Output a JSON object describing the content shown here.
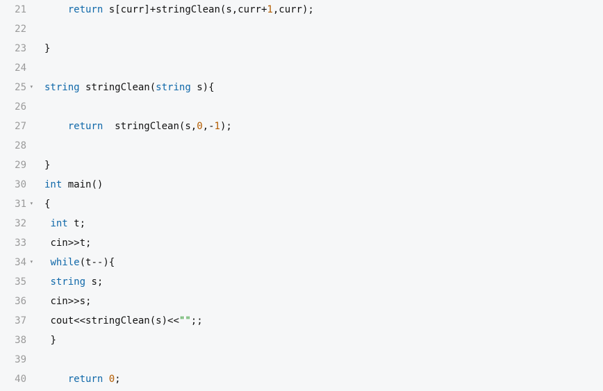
{
  "editor": {
    "first_line_number": 21,
    "lines": [
      {
        "num": 21,
        "fold": false,
        "indent": "    ",
        "tokens": [
          {
            "t": "return",
            "c": "keyword"
          },
          {
            "t": " ",
            "c": "plain"
          },
          {
            "t": "s",
            "c": "ident"
          },
          {
            "t": "[",
            "c": "punct"
          },
          {
            "t": "curr",
            "c": "ident"
          },
          {
            "t": "]",
            "c": "punct"
          },
          {
            "t": "+",
            "c": "op"
          },
          {
            "t": "stringClean",
            "c": "func"
          },
          {
            "t": "(",
            "c": "punct"
          },
          {
            "t": "s",
            "c": "ident"
          },
          {
            "t": ",",
            "c": "punct"
          },
          {
            "t": "curr",
            "c": "ident"
          },
          {
            "t": "+",
            "c": "op"
          },
          {
            "t": "1",
            "c": "num"
          },
          {
            "t": ",",
            "c": "punct"
          },
          {
            "t": "curr",
            "c": "ident"
          },
          {
            "t": ")",
            "c": "punct"
          },
          {
            "t": ";",
            "c": "punct"
          }
        ]
      },
      {
        "num": 22,
        "fold": false,
        "indent": "",
        "tokens": []
      },
      {
        "num": 23,
        "fold": false,
        "indent": "",
        "tokens": [
          {
            "t": "}",
            "c": "brace"
          }
        ]
      },
      {
        "num": 24,
        "fold": false,
        "indent": "",
        "tokens": []
      },
      {
        "num": 25,
        "fold": true,
        "indent": "",
        "tokens": [
          {
            "t": "string",
            "c": "type"
          },
          {
            "t": " ",
            "c": "plain"
          },
          {
            "t": "stringClean",
            "c": "func"
          },
          {
            "t": "(",
            "c": "punct"
          },
          {
            "t": "string",
            "c": "type"
          },
          {
            "t": " ",
            "c": "plain"
          },
          {
            "t": "s",
            "c": "ident"
          },
          {
            "t": ")",
            "c": "punct"
          },
          {
            "t": "{",
            "c": "brace"
          }
        ]
      },
      {
        "num": 26,
        "fold": false,
        "indent": "",
        "tokens": []
      },
      {
        "num": 27,
        "fold": false,
        "indent": "    ",
        "tokens": [
          {
            "t": "return",
            "c": "keyword"
          },
          {
            "t": "  ",
            "c": "plain"
          },
          {
            "t": "stringClean",
            "c": "func"
          },
          {
            "t": "(",
            "c": "punct"
          },
          {
            "t": "s",
            "c": "ident"
          },
          {
            "t": ",",
            "c": "punct"
          },
          {
            "t": "0",
            "c": "num"
          },
          {
            "t": ",",
            "c": "punct"
          },
          {
            "t": "-",
            "c": "op"
          },
          {
            "t": "1",
            "c": "num"
          },
          {
            "t": ")",
            "c": "punct"
          },
          {
            "t": ";",
            "c": "punct"
          }
        ]
      },
      {
        "num": 28,
        "fold": false,
        "indent": "",
        "tokens": []
      },
      {
        "num": 29,
        "fold": false,
        "indent": "",
        "tokens": [
          {
            "t": "}",
            "c": "brace"
          }
        ]
      },
      {
        "num": 30,
        "fold": false,
        "indent": "",
        "tokens": [
          {
            "t": "int",
            "c": "type"
          },
          {
            "t": " ",
            "c": "plain"
          },
          {
            "t": "main",
            "c": "func"
          },
          {
            "t": "(",
            "c": "punct"
          },
          {
            "t": ")",
            "c": "punct"
          }
        ]
      },
      {
        "num": 31,
        "fold": true,
        "indent": "",
        "tokens": [
          {
            "t": "{",
            "c": "brace"
          }
        ]
      },
      {
        "num": 32,
        "fold": false,
        "indent": " ",
        "tokens": [
          {
            "t": "int",
            "c": "type"
          },
          {
            "t": " ",
            "c": "plain"
          },
          {
            "t": "t",
            "c": "ident"
          },
          {
            "t": ";",
            "c": "punct"
          }
        ]
      },
      {
        "num": 33,
        "fold": false,
        "indent": " ",
        "tokens": [
          {
            "t": "cin",
            "c": "ident"
          },
          {
            "t": ">>",
            "c": "op"
          },
          {
            "t": "t",
            "c": "ident"
          },
          {
            "t": ";",
            "c": "punct"
          }
        ]
      },
      {
        "num": 34,
        "fold": true,
        "indent": " ",
        "tokens": [
          {
            "t": "while",
            "c": "keyword"
          },
          {
            "t": "(",
            "c": "punct"
          },
          {
            "t": "t",
            "c": "ident"
          },
          {
            "t": "--",
            "c": "op"
          },
          {
            "t": ")",
            "c": "punct"
          },
          {
            "t": "{",
            "c": "brace"
          }
        ]
      },
      {
        "num": 35,
        "fold": false,
        "indent": " ",
        "tokens": [
          {
            "t": "string",
            "c": "type"
          },
          {
            "t": " ",
            "c": "plain"
          },
          {
            "t": "s",
            "c": "ident"
          },
          {
            "t": ";",
            "c": "punct"
          }
        ]
      },
      {
        "num": 36,
        "fold": false,
        "indent": " ",
        "tokens": [
          {
            "t": "cin",
            "c": "ident"
          },
          {
            "t": ">>",
            "c": "op"
          },
          {
            "t": "s",
            "c": "ident"
          },
          {
            "t": ";",
            "c": "punct"
          }
        ]
      },
      {
        "num": 37,
        "fold": false,
        "indent": " ",
        "tokens": [
          {
            "t": "cout",
            "c": "ident"
          },
          {
            "t": "<<",
            "c": "op"
          },
          {
            "t": "stringClean",
            "c": "func"
          },
          {
            "t": "(",
            "c": "punct"
          },
          {
            "t": "s",
            "c": "ident"
          },
          {
            "t": ")",
            "c": "punct"
          },
          {
            "t": "<<",
            "c": "op"
          },
          {
            "t": "\"\"",
            "c": "str"
          },
          {
            "t": ";",
            "c": "punct"
          },
          {
            "t": ";",
            "c": "punct"
          }
        ]
      },
      {
        "num": 38,
        "fold": false,
        "indent": " ",
        "tokens": [
          {
            "t": "}",
            "c": "brace"
          }
        ]
      },
      {
        "num": 39,
        "fold": false,
        "indent": "",
        "tokens": []
      },
      {
        "num": 40,
        "fold": false,
        "indent": "    ",
        "tokens": [
          {
            "t": "return",
            "c": "keyword"
          },
          {
            "t": " ",
            "c": "plain"
          },
          {
            "t": "0",
            "c": "num"
          },
          {
            "t": ";",
            "c": "punct"
          }
        ]
      }
    ]
  }
}
